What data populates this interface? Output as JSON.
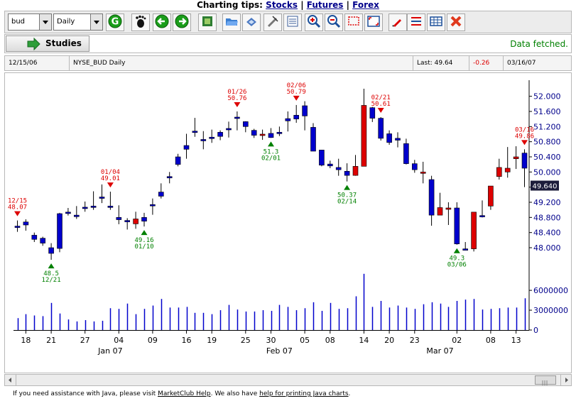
{
  "header": {
    "prefix": "Charting tips: ",
    "links": [
      "Stocks",
      "Futures",
      "Forex"
    ],
    "separator": " | "
  },
  "toolbar": {
    "symbol_value": "bud",
    "period_value": "Daily",
    "buttons": [
      "go-icon",
      "footprint-icon",
      "back-icon",
      "forward-icon",
      "save-icon",
      "open-icon",
      "print-icon",
      "draw-icon",
      "table-icon",
      "zoom-in-icon",
      "zoom-out-icon",
      "select-icon",
      "fit-icon",
      "pencil-icon",
      "lines-icon",
      "grid-icon",
      "close-icon"
    ]
  },
  "studies": {
    "label": "Studies",
    "status": "Data fetched."
  },
  "infobar": {
    "date": "12/15/06",
    "symbol": "NYSE_BUD Daily",
    "last": "Last: 49.64",
    "change": "-0.26",
    "end_date": "03/16/07"
  },
  "footer": {
    "text1": "If you need assistance with Java, please visit ",
    "link1": "MarketClub Help",
    "text2": ". We also have ",
    "link2": "help for printing Java charts",
    "text3": "."
  },
  "chart_data": {
    "type": "candlestick",
    "colors": {
      "up": "#0000cc",
      "down": "#dd0000",
      "volume": "#0000cc",
      "buy_marker": "#008000",
      "sell_marker": "#dd0000",
      "axis_text": "#00008b"
    },
    "price_axis": {
      "ticks": [
        48.0,
        48.4,
        48.8,
        49.2,
        49.6,
        50.0,
        50.4,
        50.8,
        51.2,
        51.6,
        52.0
      ],
      "labels": [
        "48.000",
        "48.400",
        "48.800",
        "49.200",
        "",
        "50.000",
        "50.400",
        "50.800",
        "51.200",
        "51.600",
        "52.000"
      ],
      "range": [
        47.55,
        52.35
      ]
    },
    "volume_axis": {
      "ticks": [
        0,
        3000000,
        6000000
      ],
      "labels": [
        "0",
        "3000000",
        "6000000"
      ],
      "range": [
        0,
        8800000
      ]
    },
    "last_price": {
      "value": 49.64,
      "label": "49.640"
    },
    "x_tick_labels": [
      "18",
      "21",
      "27",
      "04",
      "09",
      "16",
      "19",
      "25",
      "30",
      "05",
      "08",
      "14",
      "20",
      "23",
      "02",
      "08",
      "13"
    ],
    "x_tick_index": [
      1,
      4,
      8,
      12,
      16,
      20,
      23,
      27,
      30,
      34,
      37,
      41,
      44,
      47,
      52,
      56,
      59
    ],
    "month_labels": [
      "Jan 07",
      "Feb 07",
      "Mar 07"
    ],
    "month_index": [
      11,
      31,
      50
    ],
    "dates": [
      "12/15",
      "12/18",
      "12/19",
      "12/20",
      "12/21",
      "12/22",
      "12/26",
      "12/27",
      "12/28",
      "12/29",
      "01/03",
      "01/04",
      "01/05",
      "01/08",
      "01/09",
      "01/10",
      "01/11",
      "01/12",
      "01/16",
      "01/17",
      "01/18",
      "01/19",
      "01/22",
      "01/23",
      "01/24",
      "01/25",
      "01/26",
      "01/29",
      "01/30",
      "01/31",
      "02/01",
      "02/02",
      "02/05",
      "02/06",
      "02/07",
      "02/08",
      "02/09",
      "02/12",
      "02/13",
      "02/14",
      "02/15",
      "02/16",
      "02/20",
      "02/21",
      "02/22",
      "02/23",
      "02/26",
      "02/27",
      "02/28",
      "03/01",
      "03/02",
      "03/05",
      "03/06",
      "03/07",
      "03/08",
      "03/09",
      "03/12",
      "03/13",
      "03/14",
      "03/15",
      "03/16"
    ],
    "open": [
      48.57,
      48.6,
      48.22,
      48.12,
      47.85,
      47.98,
      48.94,
      48.82,
      49.07,
      49.1,
      49.34,
      49.1,
      48.74,
      48.72,
      48.76,
      48.7,
      49.14,
      49.36,
      49.85,
      50.2,
      50.6,
      51.08,
      50.86,
      50.92,
      50.94,
      51.12,
      51.45,
      51.2,
      50.97,
      51.0,
      50.91,
      51.04,
      51.35,
      51.4,
      51.48,
      50.55,
      50.18,
      50.16,
      50.06,
      49.91,
      50.15,
      51.76,
      51.42,
      50.89,
      50.78,
      50.84,
      50.22,
      50.06,
      50.0,
      48.86,
      49.06,
      49.05,
      48.1,
      47.97,
      48.94,
      48.85,
      49.63,
      50.12,
      50.1,
      50.4,
      50.1
    ],
    "close": [
      48.57,
      48.68,
      48.33,
      48.25,
      48.0,
      48.9,
      48.94,
      48.86,
      49.07,
      49.1,
      49.34,
      49.1,
      48.8,
      48.72,
      48.63,
      48.8,
      49.14,
      49.47,
      49.88,
      50.4,
      50.7,
      51.08,
      50.86,
      50.92,
      51.05,
      51.15,
      51.45,
      51.33,
      51.1,
      50.98,
      51.02,
      51.05,
      51.41,
      51.5,
      51.75,
      51.18,
      50.58,
      50.21,
      50.12,
      50.02,
      49.91,
      50.15,
      51.7,
      51.42,
      51.01,
      50.89,
      50.75,
      50.22,
      49.98,
      49.8,
      48.86,
      49.04,
      49.05,
      47.97,
      47.97,
      48.85,
      49.1,
      49.88,
      50.0,
      50.35,
      50.5
    ],
    "high": [
      48.72,
      48.75,
      48.4,
      48.29,
      48.12,
      48.92,
      49.05,
      49.1,
      49.22,
      49.49,
      49.67,
      49.48,
      49.12,
      48.78,
      48.95,
      48.92,
      49.3,
      49.7,
      50.0,
      50.48,
      51.01,
      51.43,
      51.08,
      51.12,
      51.1,
      51.33,
      51.6,
      51.34,
      51.14,
      51.12,
      51.16,
      51.2,
      51.6,
      51.77,
      51.87,
      51.29,
      50.58,
      50.3,
      50.35,
      50.23,
      50.45,
      52.2,
      51.72,
      51.45,
      51.1,
      51.05,
      50.88,
      50.32,
      50.27,
      49.9,
      49.45,
      49.2,
      49.2,
      48.15,
      48.21,
      49.25,
      49.4,
      50.35,
      50.66,
      50.68,
      50.6
    ],
    "low": [
      48.42,
      48.45,
      48.15,
      48.05,
      47.68,
      47.88,
      48.85,
      48.76,
      48.95,
      49.0,
      49.18,
      49.0,
      48.62,
      48.48,
      48.5,
      48.56,
      48.87,
      49.3,
      49.7,
      50.15,
      50.35,
      50.93,
      50.6,
      50.77,
      50.84,
      50.91,
      51.1,
      51.05,
      50.9,
      50.85,
      50.9,
      50.95,
      51.07,
      51.3,
      51.1,
      50.55,
      50.15,
      50.1,
      49.9,
      49.75,
      49.9,
      51.65,
      51.32,
      50.83,
      50.72,
      50.65,
      50.2,
      49.98,
      49.7,
      48.58,
      48.9,
      48.6,
      48.08,
      47.94,
      47.9,
      48.8,
      49.0,
      49.8,
      49.85,
      50.08,
      49.6
    ],
    "volume": [
      1800000,
      2400000,
      2200000,
      2100000,
      4100000,
      2500000,
      1600000,
      1300000,
      1500000,
      1300000,
      1400000,
      3300000,
      3200000,
      4000000,
      2400000,
      3200000,
      3700000,
      4700000,
      3400000,
      3400000,
      3500000,
      2600000,
      2600000,
      2400000,
      3000000,
      3800000,
      3100000,
      2800000,
      2800000,
      3000000,
      2900000,
      3800000,
      3500000,
      3000000,
      3300000,
      4200000,
      2900000,
      4100000,
      3200000,
      3300000,
      5100000,
      8500000,
      3500000,
      4400000,
      3400000,
      3700000,
      3400000,
      3200000,
      3900000,
      4200000,
      4000000,
      3500000,
      4400000,
      4600000,
      4700000,
      3100000,
      3200000,
      3300000,
      3400000,
      3400000,
      4800000
    ],
    "signals": [
      {
        "index": 0,
        "kind": "sell",
        "date": "12/15",
        "price": "48.07"
      },
      {
        "index": 4,
        "kind": "buy",
        "date": "12/21",
        "price": "48.5"
      },
      {
        "index": 11,
        "kind": "sell",
        "date": "01/04",
        "price": "49.01"
      },
      {
        "index": 15,
        "kind": "buy",
        "date": "01/10",
        "price": "49.16"
      },
      {
        "index": 26,
        "kind": "sell",
        "date": "01/26",
        "price": "50.76"
      },
      {
        "index": 30,
        "kind": "buy",
        "date": "02/01",
        "price": "51.3"
      },
      {
        "index": 33,
        "kind": "sell",
        "date": "02/06",
        "price": "50.79"
      },
      {
        "index": 39,
        "kind": "buy",
        "date": "02/14",
        "price": "50.37"
      },
      {
        "index": 43,
        "kind": "sell",
        "date": "02/21",
        "price": "50.61"
      },
      {
        "index": 52,
        "kind": "buy",
        "date": "03/06",
        "price": "49.3"
      },
      {
        "index": 60,
        "kind": "sell",
        "date": "03/16",
        "price": "49.86"
      }
    ]
  }
}
